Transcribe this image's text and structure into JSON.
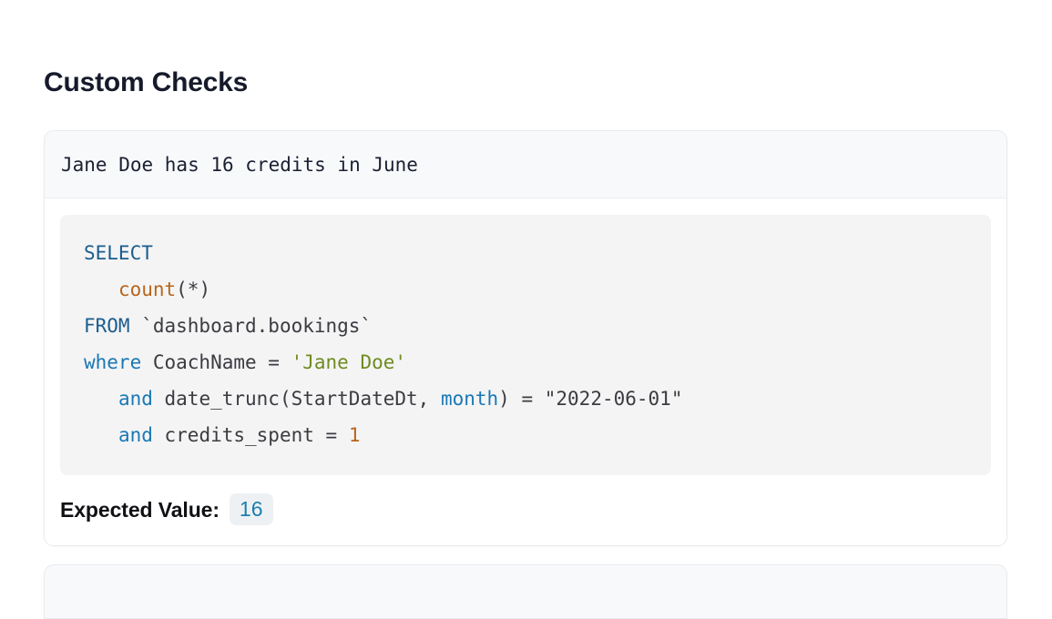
{
  "page": {
    "title": "Custom Checks",
    "background_color": "#ffffff"
  },
  "colors": {
    "title_text": "#161a2b",
    "card_border": "#e9eaee",
    "card_header_bg": "#f8f9fb",
    "code_block_bg": "#f4f4f5",
    "badge_bg": "#eef1f4",
    "badge_text": "#1b7fb0",
    "sql_keyword": "#1a5d8f",
    "sql_keyword_alt": "#1978b4",
    "sql_function": "#b8651b",
    "sql_number": "#b8651b",
    "sql_string": "#6f8b1f",
    "sql_plain": "#3b3b41"
  },
  "check": {
    "header_text": "Jane Doe has 16 credits in June",
    "code_lines": [
      [
        {
          "t": "SELECT",
          "c": "kw"
        }
      ],
      [
        {
          "t": "   ",
          "c": "plain"
        },
        {
          "t": "count",
          "c": "fn"
        },
        {
          "t": "(*)",
          "c": "plain"
        }
      ],
      [
        {
          "t": "FROM",
          "c": "kw"
        },
        {
          "t": " `dashboard.bookings`",
          "c": "plain"
        }
      ],
      [
        {
          "t": "where",
          "c": "kw2"
        },
        {
          "t": " CoachName = ",
          "c": "plain"
        },
        {
          "t": "'Jane Doe'",
          "c": "str"
        }
      ],
      [
        {
          "t": "   ",
          "c": "plain"
        },
        {
          "t": "and",
          "c": "kw2"
        },
        {
          "t": " date_trunc(StartDateDt, ",
          "c": "plain"
        },
        {
          "t": "month",
          "c": "kw2"
        },
        {
          "t": ") = \"2022-06-01\"",
          "c": "plain"
        }
      ],
      [
        {
          "t": "   ",
          "c": "plain"
        },
        {
          "t": "and",
          "c": "kw2"
        },
        {
          "t": " credits_spent = ",
          "c": "plain"
        },
        {
          "t": "1",
          "c": "num"
        }
      ]
    ],
    "expected_value_label": "Expected Value:",
    "expected_value": "16"
  }
}
